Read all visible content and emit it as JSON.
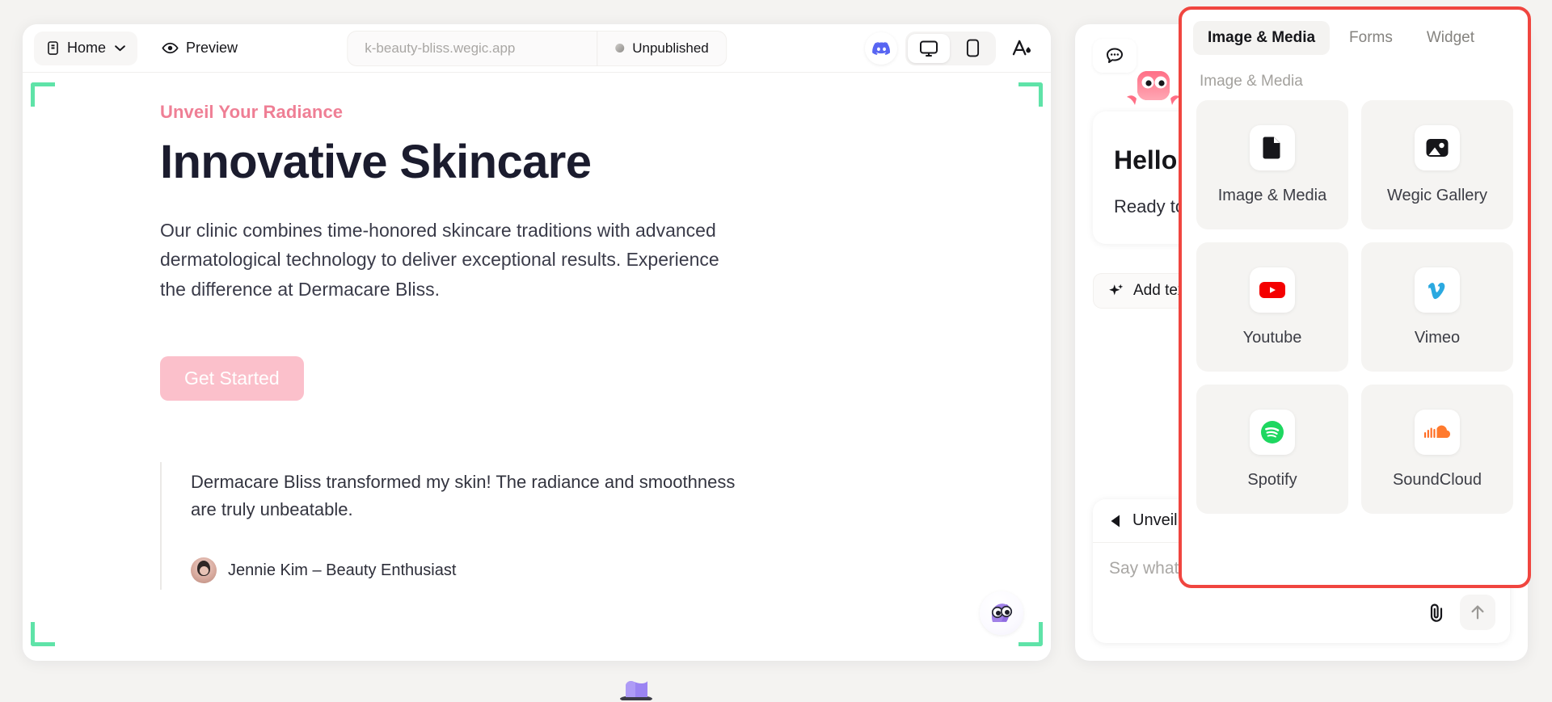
{
  "topbar": {
    "home_label": "Home",
    "home_icon": "page-icon",
    "chevron_icon": "chevron-down-icon",
    "preview_label": "Preview",
    "preview_icon": "eye-icon",
    "url_value": "k-beauty-bliss.wegic.app",
    "publish_status": "Unpublished",
    "discord_icon": "discord-icon",
    "desktop_icon": "desktop-icon",
    "mobile_icon": "mobile-icon",
    "theme_icon": "font-color-icon"
  },
  "canvas": {
    "eyebrow": "Unveil Your Radiance",
    "title": "Innovative Skincare",
    "body": "Our clinic combines time-honored skincare traditions with advanced dermatological technology to deliver exceptional results. Experience the difference at Dermacare Bliss.",
    "cta_label": "Get Started",
    "quote": "Dermacare Bliss transformed my skin! The radiance and smoothness are truly unbeatable.",
    "quote_author": "Jennie Kim – Beauty Enthusiast",
    "selection_color": "#5fe3a8",
    "accent_pink": "#ef7f95",
    "cta_bg": "#fbc0cb"
  },
  "chat": {
    "bubble_icon": "chat-bubble-icon",
    "mascot_icon": "pink-mascot-icon",
    "hello_title": "Hello",
    "hello_body": "Ready to explore what you can do?",
    "add_text_label": "Add text",
    "add_text_icon": "sparkle-icon",
    "context_label": "Unveil Your Radiance",
    "context_icon": "back-arrow-icon",
    "composer_placeholder": "Say what you want",
    "attach_icon": "paperclip-icon",
    "send_icon": "arrow-up-icon"
  },
  "media_popover": {
    "highlight_color": "#f0453f",
    "tabs": [
      {
        "label": "Image & Media",
        "active": true
      },
      {
        "label": "Forms",
        "active": false
      },
      {
        "label": "Widget",
        "active": false
      }
    ],
    "section_title": "Image & Media",
    "items": [
      {
        "label": "Image & Media",
        "icon": "file-image-icon"
      },
      {
        "label": "Wegic Gallery",
        "icon": "gallery-icon"
      },
      {
        "label": "Youtube",
        "icon": "youtube-icon"
      },
      {
        "label": "Vimeo",
        "icon": "vimeo-icon"
      },
      {
        "label": "Spotify",
        "icon": "spotify-icon"
      },
      {
        "label": "SoundCloud",
        "icon": "soundcloud-icon"
      }
    ]
  }
}
